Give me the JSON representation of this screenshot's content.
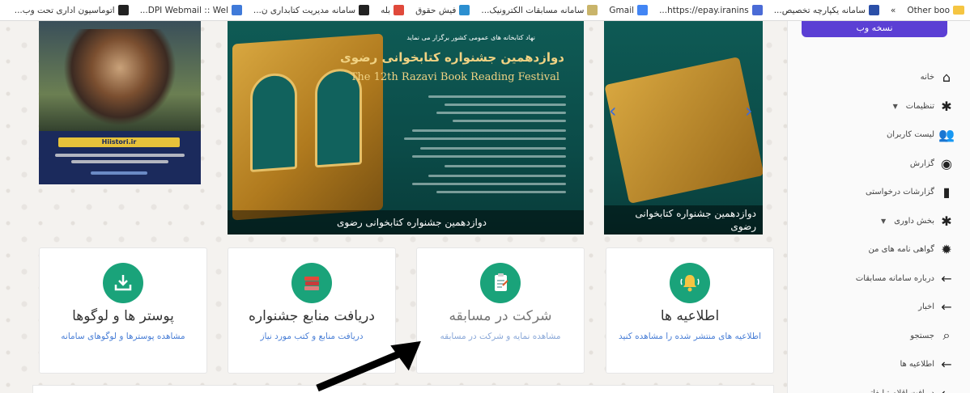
{
  "bookmarks": [
    {
      "label": "Other boo",
      "icon": "folder-icon",
      "color": "#f5c542"
    },
    {
      "label": "»",
      "icon": "",
      "color": ""
    },
    {
      "label": "سامانه یکپارچه تخصیص...",
      "icon": "flag-icon",
      "color": "#2b4fa8"
    },
    {
      "label": "https://epay.iranins...",
      "icon": "globe-icon",
      "color": "#4a6bd6"
    },
    {
      "label": "Gmail",
      "icon": "google-icon",
      "color": "#4285f4"
    },
    {
      "label": "سامانه مسابقات الکترونیک...",
      "icon": "circle-logo-icon",
      "color": "#c9b46a"
    },
    {
      "label": "فیش حقوق",
      "icon": "document-icon",
      "color": "#2c8fd0"
    },
    {
      "label": "بله",
      "icon": "chat-icon",
      "color": "#e0493b"
    },
    {
      "label": "سامانه مدیریت کتابداری ن...",
      "icon": "book-icon",
      "color": "#222222"
    },
    {
      "label": "DPI Webmail :: Wel...",
      "icon": "mail-icon",
      "color": "#3f7ad9"
    },
    {
      "label": "اتوماسیون اداری تحت وب...",
      "icon": "web-icon",
      "color": "#222222"
    }
  ],
  "sidebar": {
    "web_button_label": "نسخه وب",
    "items": [
      {
        "label": "خانه",
        "icon": "home-icon",
        "glyph": "⌂",
        "has_caret": false
      },
      {
        "label": "تنظیمات",
        "icon": "gear-icon",
        "glyph": "✱",
        "has_caret": true
      },
      {
        "label": "لیست کاربران",
        "icon": "users-icon",
        "glyph": "👥",
        "has_caret": false
      },
      {
        "label": "گزارش",
        "icon": "gamepad-icon",
        "glyph": "◉",
        "has_caret": false
      },
      {
        "label": "گزارشات درخواستی",
        "icon": "file-icon",
        "glyph": "▮",
        "has_caret": false
      },
      {
        "label": "بخش داوری",
        "icon": "gear-icon",
        "glyph": "✱",
        "has_caret": true
      },
      {
        "label": "گواهی نامه های من",
        "icon": "certificate-icon",
        "glyph": "✹",
        "has_caret": false
      },
      {
        "label": "درباره سامانه مسابقات",
        "icon": "arrow-left-icon",
        "glyph": "←",
        "has_caret": false
      },
      {
        "label": "اخبار",
        "icon": "arrow-left-icon",
        "glyph": "←",
        "has_caret": false
      },
      {
        "label": "جستجو",
        "icon": "search-icon",
        "glyph": "⌕",
        "has_caret": false
      },
      {
        "label": "اطلاعیه ها",
        "icon": "arrow-left-icon",
        "glyph": "←",
        "has_caret": false
      },
      {
        "label": "دریافت اقلام تبلیغاتی",
        "icon": "arrow-left-icon",
        "glyph": "←",
        "has_caret": false
      }
    ]
  },
  "banners": {
    "left": {
      "tag_text": "Hiistori.ir"
    },
    "center": {
      "top_line": "نهاد کتابخانه های عمومی کشور برگزار می نماید",
      "title_fa": "دوازدهمین جشنواره کتابخوانی رضوی",
      "title_en": "The 12th Razavi Book Reading Festival",
      "caption": "دوازدهمین جشنواره کتابخوانی رضوی"
    },
    "right": {
      "caption": "دوازدهمین جشنواره کتابخوانی رضوی"
    }
  },
  "cards": [
    {
      "title": "اطلاعیه ها",
      "subtitle": "اطلاعیه های منتشر شده را مشاهده کنید",
      "icon": "bell-icon",
      "color": "#1aa37a"
    },
    {
      "title": "شرکت در مسابقه",
      "subtitle": "مشاهده نمایه و شرکت در مسابقه",
      "icon": "clipboard-icon",
      "color": "#1aa37a"
    },
    {
      "title": "دریافت منابع جشنواره",
      "subtitle": "دریافت منابع و کتب مورد نیاز",
      "icon": "books-icon",
      "color": "#1aa37a"
    },
    {
      "title": "پوستر ها و لوگوها",
      "subtitle": "مشاهده پوسترها و لوگوهای سامانه",
      "icon": "download-icon",
      "color": "#1aa37a"
    }
  ],
  "colors": {
    "accent": "#5b3fd4",
    "link": "#4a7fd6",
    "card_icon_bg": "#1aa37a"
  }
}
